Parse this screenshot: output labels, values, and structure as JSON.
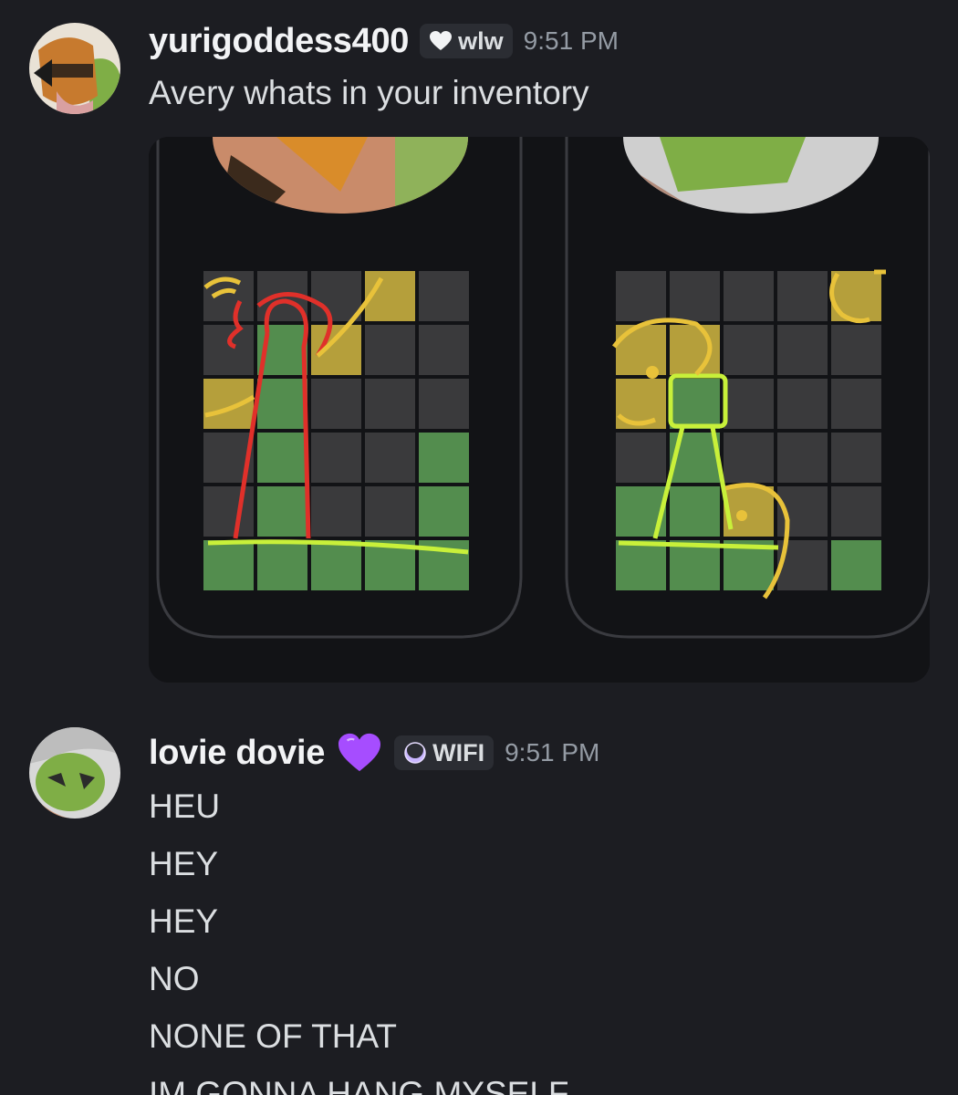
{
  "messages": [
    {
      "username": "yurigoddess400",
      "tag": {
        "icon": "heart-icon",
        "label": "wlw"
      },
      "timestamp": "9:51 PM",
      "lines": [
        "Avery whats in your inventory"
      ],
      "attachment": "image"
    },
    {
      "username": "lovie dovie",
      "emoji": "purple-heart-icon",
      "tag": {
        "icon": "moon-icon",
        "label": "WIFI"
      },
      "timestamp": "9:51 PM",
      "lines": [
        "HEU",
        "HEY",
        "HEY",
        "NO",
        "NONE OF THAT",
        "IM GONNA HANG MYSELF"
      ]
    }
  ],
  "colors": {
    "background": "#1c1d22",
    "tile_green": "#538d4e",
    "tile_yellow": "#b59f3b",
    "tile_gray": "#3a3a3c",
    "purple_heart": "#a64dff"
  }
}
